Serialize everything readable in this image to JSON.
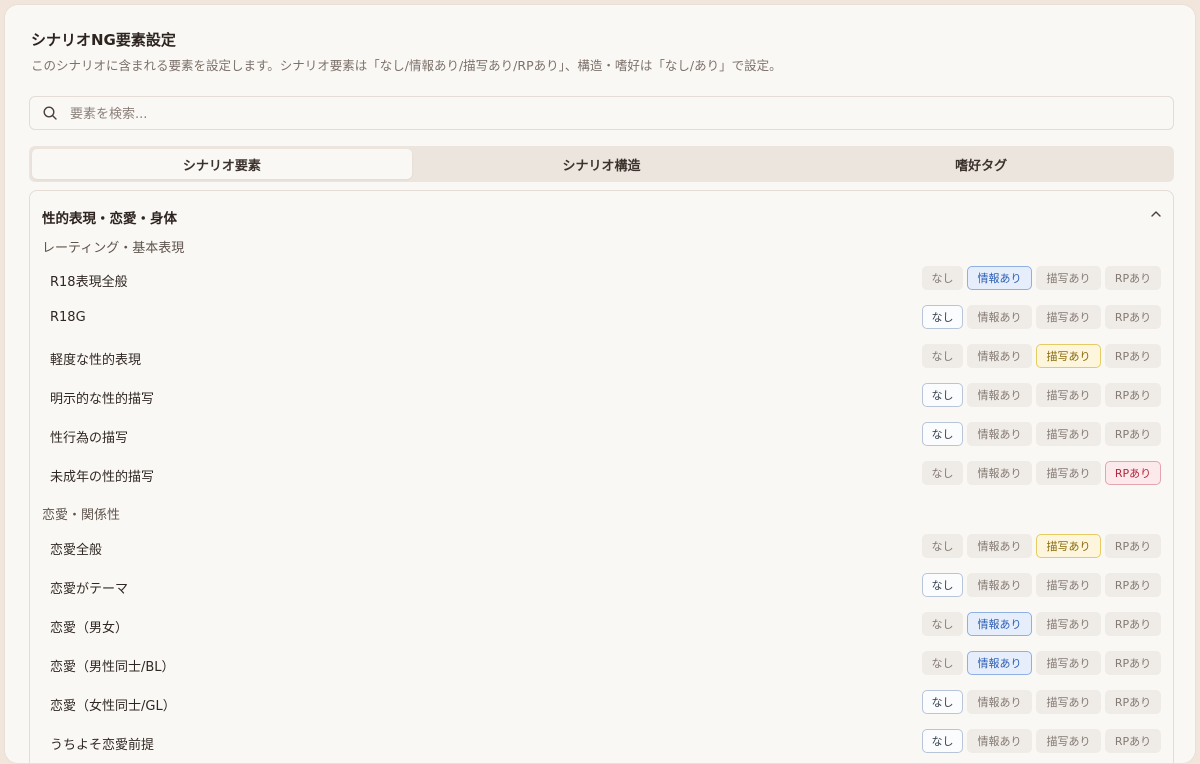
{
  "header": {
    "title": "シナリオNG要素設定",
    "subtitle": "このシナリオに含まれる要素を設定します。シナリオ要素は「なし/情報あり/描写あり/RPあり」、構造・嗜好は「なし/あり」で設定。"
  },
  "search": {
    "placeholder": "要素を検索..."
  },
  "tabs": [
    {
      "label": "シナリオ要素",
      "active": true
    },
    {
      "label": "シナリオ構造",
      "active": false
    },
    {
      "label": "嗜好タグ",
      "active": false
    }
  ],
  "section": {
    "title": "性的表現・恋愛・身体",
    "options": [
      "なし",
      "情報あり",
      "描写あり",
      "RPあり"
    ],
    "groups": [
      {
        "label": "レーティング・基本表現",
        "items": [
          {
            "label": "R18表現全般",
            "selected": 1
          },
          {
            "label": "R18G",
            "selected": 0
          },
          {
            "label": "軽度な性的表現",
            "selected": 2
          },
          {
            "label": "明示的な性的描写",
            "selected": 0
          },
          {
            "label": "性行為の描写",
            "selected": 0
          },
          {
            "label": "未成年の性的描写",
            "selected": 3
          }
        ]
      },
      {
        "label": "恋愛・関係性",
        "items": [
          {
            "label": "恋愛全般",
            "selected": 2
          },
          {
            "label": "恋愛がテーマ",
            "selected": 0
          },
          {
            "label": "恋愛（男女）",
            "selected": 1
          },
          {
            "label": "恋愛（男性同士/BL）",
            "selected": 1
          },
          {
            "label": "恋愛（女性同士/GL）",
            "selected": 0
          },
          {
            "label": "うちよそ恋愛前提",
            "selected": 0
          }
        ]
      }
    ]
  },
  "colors": {
    "background": "#faf8f4",
    "selected_none": "#b8c5d8",
    "selected_info": "#2d5fb5",
    "selected_draw": "#e6cb62",
    "selected_rp": "#b3283d"
  },
  "icons": {
    "search": "search-icon",
    "collapse": "chevron-up-icon"
  }
}
